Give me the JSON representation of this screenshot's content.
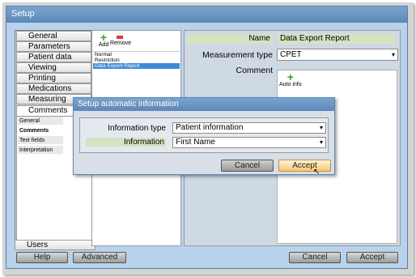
{
  "window": {
    "title": "Setup"
  },
  "nav": {
    "items": [
      "General",
      "Parameters",
      "Patient data",
      "Viewing",
      "Printing",
      "Medications",
      "Measuring"
    ],
    "active": "Comments",
    "subitems": [
      "General",
      "Comments",
      "Text fields",
      "Interpretation"
    ],
    "bottom": "Users"
  },
  "list": {
    "add_label": "Add",
    "remove_label": "Remove",
    "items": [
      "Normal",
      "Restriction",
      "Data Export Report"
    ]
  },
  "detail": {
    "name_label": "Name",
    "name_value": "Data Export Report",
    "type_label": "Measurement type",
    "type_value": "CPET",
    "comment_label": "Comment",
    "autoinfo_label": "Auto info"
  },
  "buttons": {
    "help": "Help",
    "advanced": "Advanced",
    "cancel": "Cancel",
    "accept": "Accept"
  },
  "dialog": {
    "title": "Setup automatic information",
    "info_type_label": "Information type",
    "info_type_value": "Patient information",
    "info_label": "Information",
    "info_value": "First Name",
    "cancel": "Cancel",
    "accept": "Accept"
  },
  "colors": {
    "accent": "#5d87b6",
    "highlight": "#d4e4c0",
    "selection": "#3c8ad8"
  }
}
